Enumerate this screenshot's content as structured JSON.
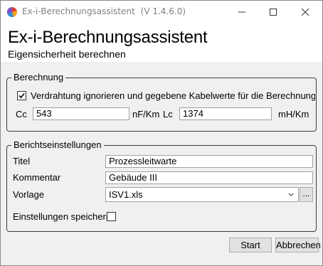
{
  "window": {
    "title": "Ex-i-Berechnungsassistent",
    "version": "(V 1.4.6.0)",
    "icon": "app-logo-icon",
    "controls": [
      "minimize-icon",
      "maximize-icon",
      "close-icon"
    ]
  },
  "header": {
    "title": "Ex-i-Berechnungsassistent",
    "subtitle": "Eigensicherheit berechnen"
  },
  "berechnung": {
    "legend": "Berechnung",
    "checkbox_label": "Verdrahtung ignorieren und gegebene Kabelwerte für die Berechnung ver",
    "checkbox_checked": true,
    "cc_label": "Cc",
    "cc_value": "543",
    "cc_unit": "nF/Km",
    "lc_label": "Lc",
    "lc_value": "1374",
    "lc_unit": "mH/Km"
  },
  "bericht": {
    "legend": "Berichtseinstellungen",
    "titel_label": "Titel",
    "titel_value": "Prozessleitwarte",
    "kommentar_label": "Kommentar",
    "kommentar_value": "Gebäude III",
    "vorlage_label": "Vorlage",
    "vorlage_value": "ISV1.xls",
    "browse_label": "...",
    "save_label": "Einstellungen speichern",
    "save_checked": false
  },
  "buttons": {
    "start": "Start",
    "cancel": "Abbrechen"
  }
}
